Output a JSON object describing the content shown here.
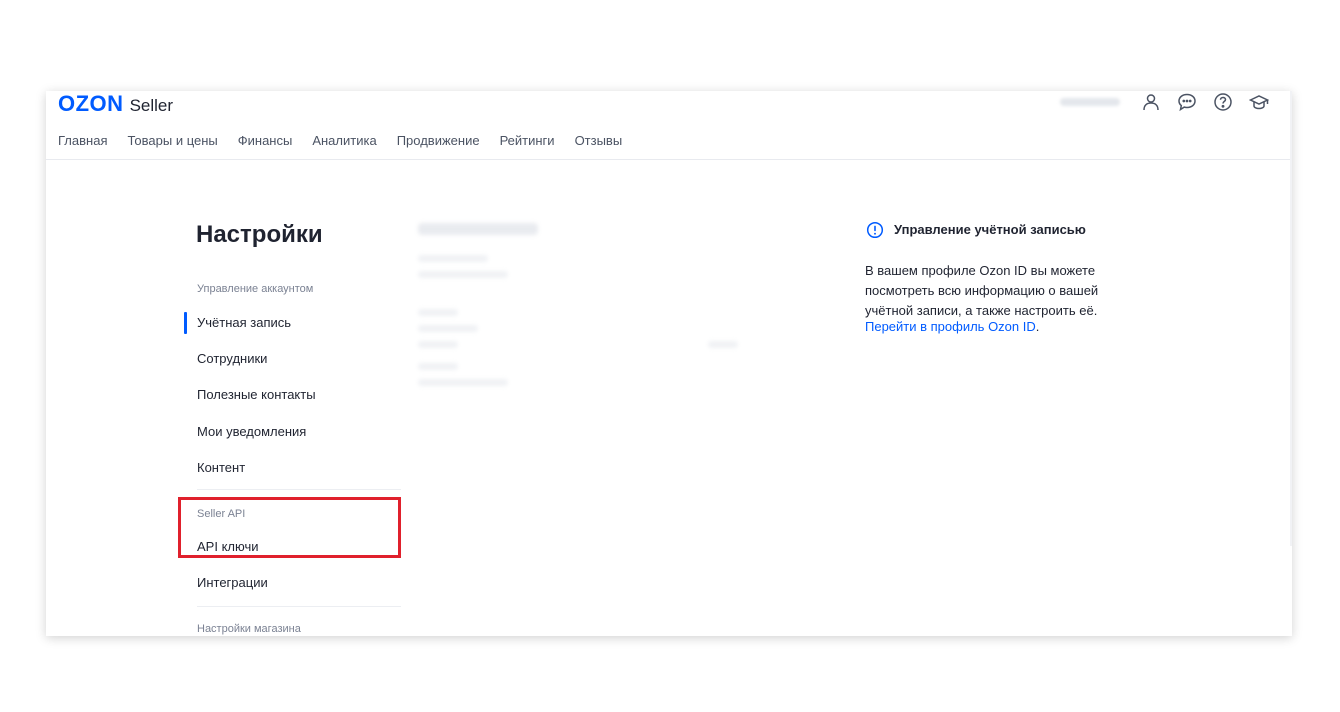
{
  "header": {
    "logo_brand": "OZON",
    "logo_product": "Seller",
    "icons": [
      "user-icon",
      "chat-icon",
      "help-icon",
      "education-icon"
    ]
  },
  "nav": {
    "items": [
      "Главная",
      "Товары и цены",
      "Финансы",
      "Аналитика",
      "Продвижение",
      "Рейтинги",
      "Отзывы"
    ]
  },
  "settings": {
    "title": "Настройки",
    "section_account": "Управление аккаунтом",
    "account_items": [
      "Учётная запись",
      "Сотрудники",
      "Полезные контакты",
      "Мои уведомления",
      "Контент"
    ],
    "section_api": "Seller API",
    "api_items": [
      "API ключи",
      "Интеграции"
    ],
    "section_store": "Настройки магазина"
  },
  "info_panel": {
    "title": "Управление учётной записью",
    "text": "В вашем профиле Ozon ID вы можете посмотреть всю информацию о вашей учётной записи, а также настроить её.",
    "link": "Перейти в профиль Ozon ID",
    "link_suffix": "."
  },
  "colors": {
    "brand": "#005bff",
    "highlight": "#e0202c",
    "text": "#1f2330",
    "muted": "#7b8293"
  }
}
